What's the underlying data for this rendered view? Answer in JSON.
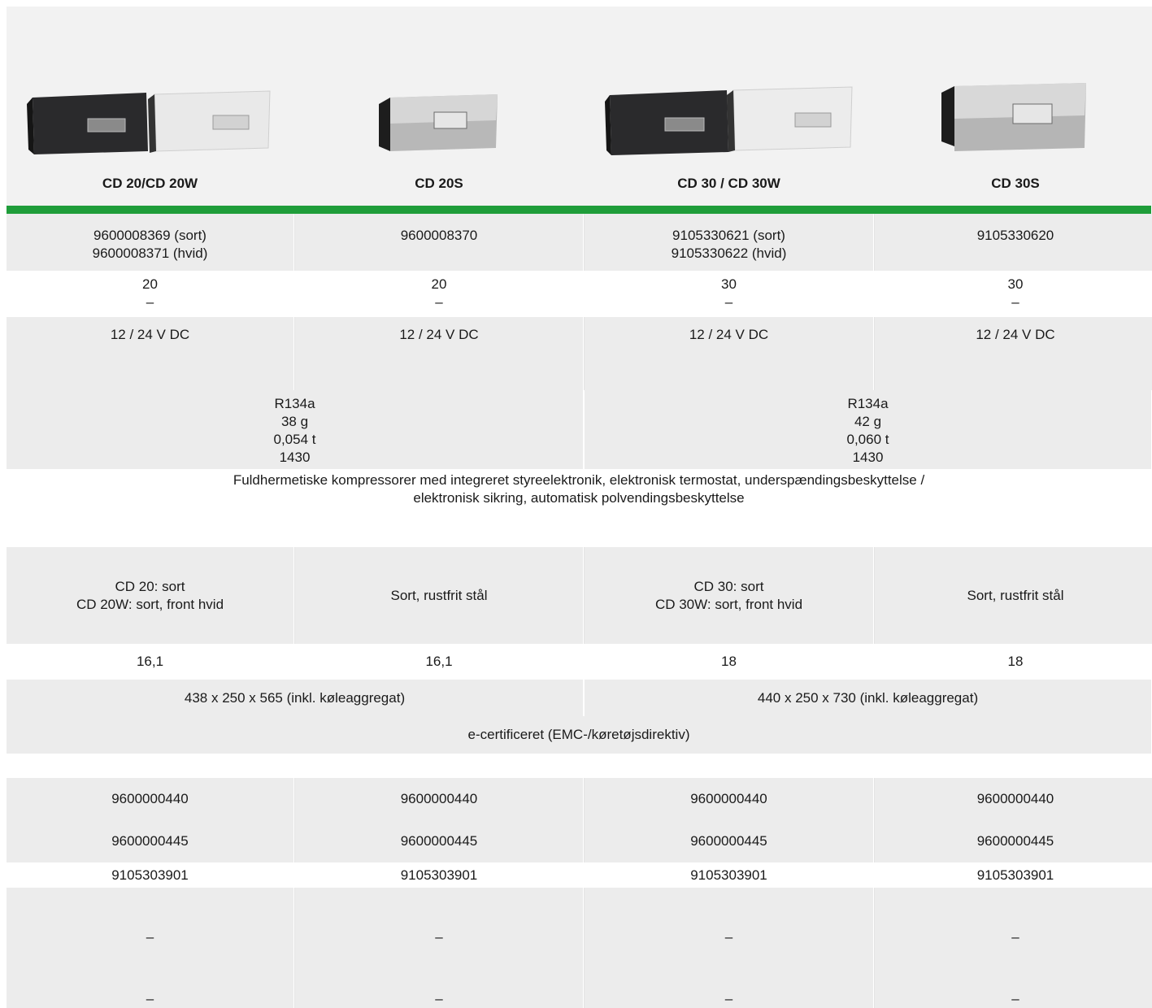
{
  "header": {
    "models": [
      "CD 20/CD 20W",
      "CD 20S",
      "CD 30 / CD 30W",
      "CD 30S"
    ],
    "images": [
      {
        "icon": "drawer-fridge-black-and-white-icon"
      },
      {
        "icon": "drawer-fridge-stainless-icon"
      },
      {
        "icon": "drawer-fridge-black-and-white-icon"
      },
      {
        "icon": "drawer-fridge-stainless-icon"
      }
    ]
  },
  "colors": {
    "accent_bar": "#1f9d3a",
    "row_shade": "#ececec",
    "header_bg": "#f2f2f2"
  },
  "rows": {
    "article_numbers": [
      [
        "9600008369 (sort)",
        "9600008371 (hvid)"
      ],
      [
        "9600008370"
      ],
      [
        "9105330621 (sort)",
        "9105330622 (hvid)"
      ],
      [
        "9105330620"
      ]
    ],
    "capacity": [
      [
        "20",
        "–"
      ],
      [
        "20",
        "–"
      ],
      [
        "30",
        "–"
      ],
      [
        "30",
        "–"
      ]
    ],
    "voltage": [
      "12 / 24 V DC",
      "12 / 24 V DC",
      "12 / 24 V DC",
      "12 / 24 V DC"
    ],
    "refrigerant": [
      [
        "R134a",
        "38 g",
        "0,054 t",
        "1430"
      ],
      [
        "R134a",
        "42 g",
        "0,060 t",
        "1430"
      ]
    ],
    "compressor": [
      "Fuldhermetiske kompressorer med integreret styreelektronik, elektronisk termostat, underspændingsbeskyttelse /",
      "elektronisk sikring, automatisk polvendingsbeskyttelse"
    ],
    "color": [
      [
        "CD 20: sort",
        "CD 20W: sort, front hvid"
      ],
      [
        "Sort, rustfrit stål"
      ],
      [
        "CD 30: sort",
        "CD 30W: sort, front hvid"
      ],
      [
        "Sort, rustfrit stål"
      ]
    ],
    "weight": [
      "16,1",
      "16,1",
      "18",
      "18"
    ],
    "dimensions": [
      "438 x 250 x 565 (inkl. køleaggregat)",
      "440 x 250 x 730 (inkl. køleaggregat)"
    ],
    "certification": "e-certificeret (EMC-/køretøjsdirektiv)",
    "accessory_1": [
      "9600000440",
      "9600000440",
      "9600000440",
      "9600000440"
    ],
    "accessory_2": [
      "9600000445",
      "9600000445",
      "9600000445",
      "9600000445"
    ],
    "accessory_3": [
      "9105303901",
      "9105303901",
      "9105303901",
      "9105303901"
    ],
    "accessory_4": [
      "–",
      "–",
      "–",
      "–"
    ],
    "accessory_5": [
      "–",
      "–",
      "–",
      "–"
    ]
  }
}
